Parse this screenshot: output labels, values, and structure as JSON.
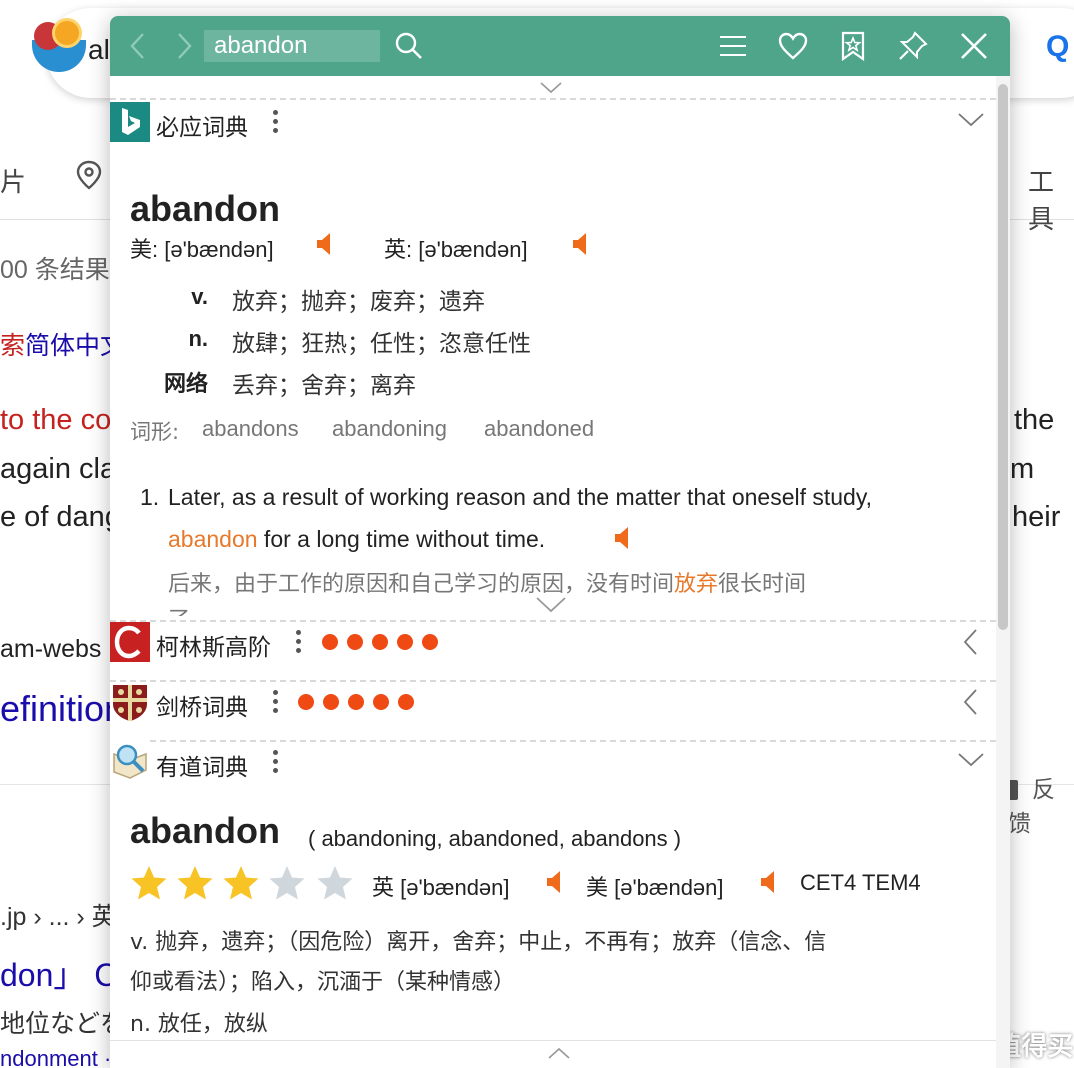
{
  "background": {
    "logo_text": "al",
    "tab_images": "片",
    "tools": "工具",
    "result_count": "00 条结果",
    "link_prefix": "索",
    "link_main": "简体中文",
    "line1": "to the co",
    "line1_right": "the",
    "line2": "again cla",
    "line2_right": "m",
    "line3": "e of dang",
    "line3_right": "heir",
    "url": "am-webs",
    "title": "efinition",
    "feedback": "反馈",
    "crumb": ".jp › ... › 英",
    "title2": "don」 C",
    "snippet": "地位などを",
    "under": "ndonment · abandoning",
    "watermark": "值 什么值得买"
  },
  "toolbar": {
    "search_value": "abandon",
    "accent": "#4fa58a"
  },
  "bing": {
    "name": "必应词典",
    "word": "abandon",
    "pron_us": "美: [ə'bændən]",
    "pron_uk": "英: [ə'bændən]",
    "defs": [
      {
        "pos": "v.",
        "text": "放弃；抛弃；废弃；遗弃"
      },
      {
        "pos": "n.",
        "text": "放肆；狂热；任性；恣意任性"
      },
      {
        "pos": "网络",
        "text": "丢弃；舍弃；离弃"
      }
    ],
    "forms_label": "词形:",
    "forms": [
      "abandons",
      "abandoning",
      "abandoned"
    ],
    "example_number": "1.",
    "example_line1": "Later, as a result of working reason and the matter that oneself study,",
    "example_hl": "abandon",
    "example_line2_rest": " for a long time without time.",
    "example_cn_before": "后来，由于工作的原因和自己学习的原因，没有时间",
    "example_cn_hl": "放弃",
    "example_cn_after": "很长时间",
    "example_cn_cut": "了"
  },
  "collins": {
    "name": "柯林斯高阶",
    "rating_dots": 5
  },
  "cambridge": {
    "name": "剑桥词典",
    "rating_dots": 5
  },
  "youdao": {
    "name": "有道词典",
    "word": "abandon",
    "inflections": "( abandoning, abandoned, abandons )",
    "stars_filled": 3,
    "stars_total": 5,
    "pron_uk": "英 [ə'bændən]",
    "pron_us": "美 [ə'bændən]",
    "tags": "CET4 TEM4",
    "def_v_line1": "v. 抛弃，遗弃；（因危险）离开，舍弃；中止，不再有；放弃（信念、信",
    "def_v_line2": "仰或看法）；陷入，沉湎于（某种情感）",
    "def_n": "n. 放任，放纵"
  },
  "colors": {
    "speaker": "#f06a1c",
    "highlight": "#e6792b",
    "dot": "#f04a14",
    "star_on": "#f7c325",
    "star_off": "#cfd6dc"
  }
}
